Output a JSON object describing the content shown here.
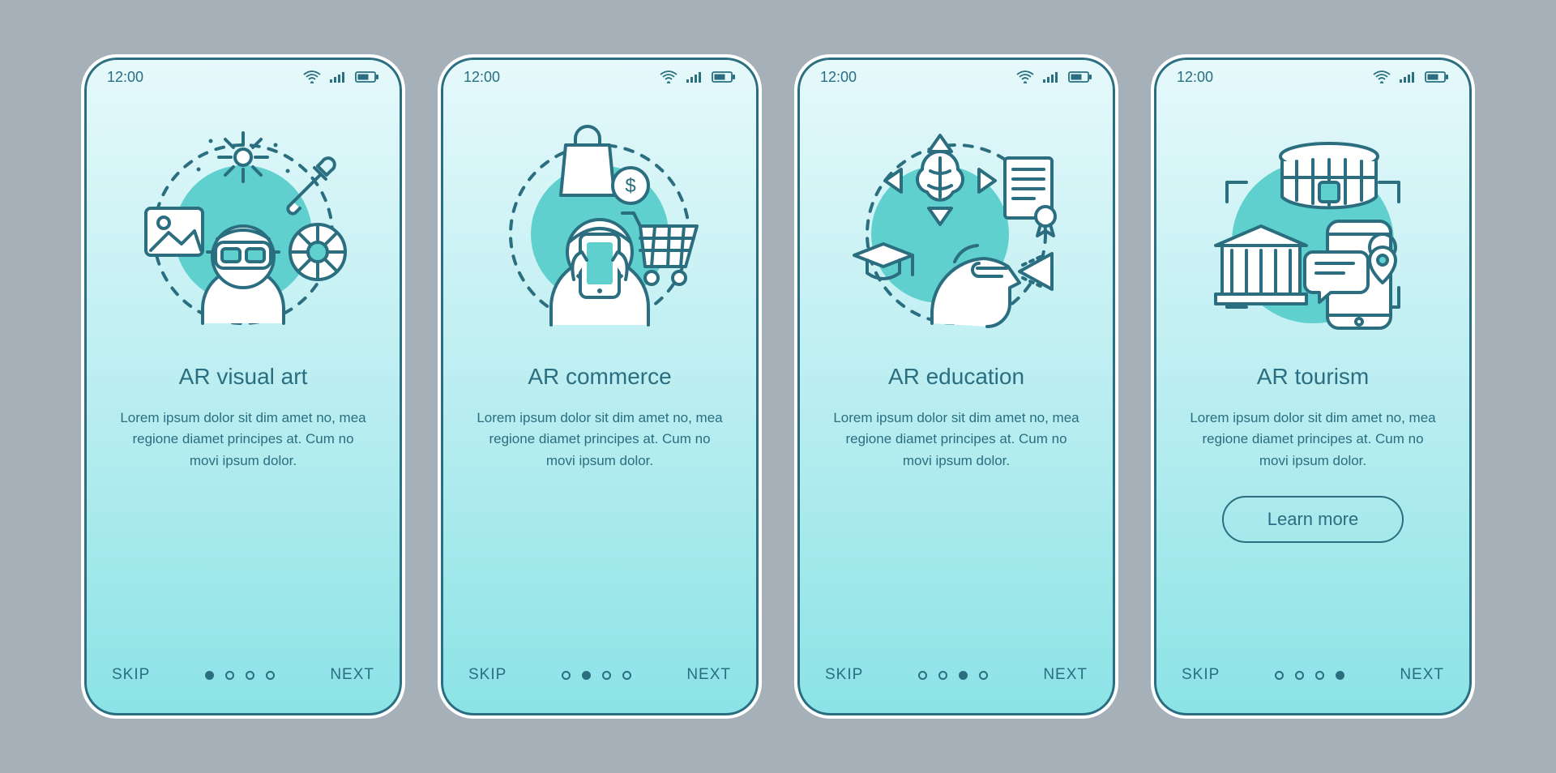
{
  "status": {
    "time": "12:00",
    "icons": [
      "wifi-icon",
      "signal-icon",
      "battery-icon"
    ]
  },
  "nav": {
    "skip_label": "SKIP",
    "next_label": "NEXT",
    "learn_more_label": "Learn more",
    "total_dots": 4
  },
  "colors": {
    "stroke": "#2a6e80",
    "accent_fill": "#5fd0ce",
    "bg_top": "#e6f9fb",
    "bg_bottom": "#8be3e6"
  },
  "screens": [
    {
      "id": "visual-art",
      "title": "AR visual art",
      "body": "Lorem ipsum dolor sit dim amet no, mea regione diamet principes at. Cum no movi ipsum dolor.",
      "active_dot": 0,
      "illustration": "ar-visual-art-icon",
      "has_learn_more": false
    },
    {
      "id": "commerce",
      "title": "AR commerce",
      "body": "Lorem ipsum dolor sit dim amet no, mea regione diamet principes at. Cum no movi ipsum dolor.",
      "active_dot": 1,
      "illustration": "ar-commerce-icon",
      "has_learn_more": false
    },
    {
      "id": "education",
      "title": "AR education",
      "body": "Lorem ipsum dolor sit dim amet no, mea regione diamet principes at. Cum no movi ipsum dolor.",
      "active_dot": 2,
      "illustration": "ar-education-icon",
      "has_learn_more": false
    },
    {
      "id": "tourism",
      "title": "AR tourism",
      "body": "Lorem ipsum dolor sit dim amet no, mea regione diamet principes at. Cum no movi ipsum dolor.",
      "active_dot": 3,
      "illustration": "ar-tourism-icon",
      "has_learn_more": true
    }
  ]
}
